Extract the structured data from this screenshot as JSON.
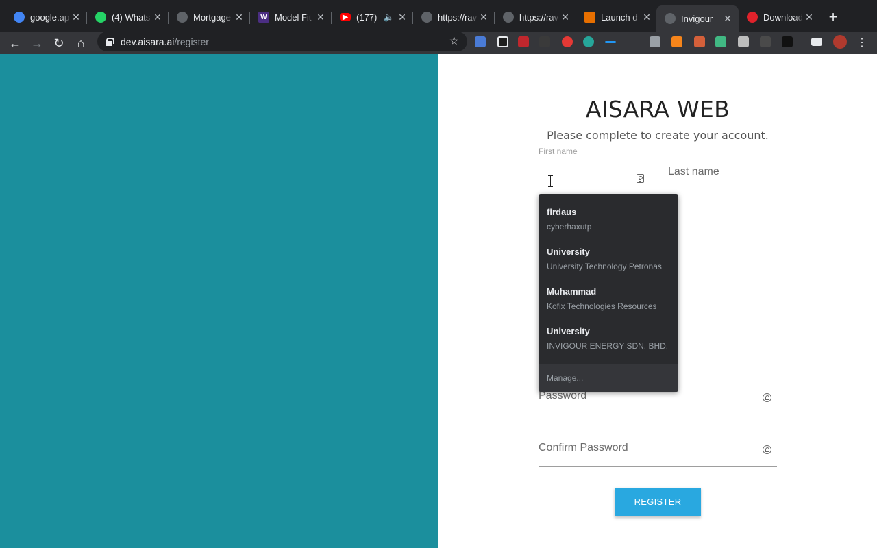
{
  "browser": {
    "tabs": [
      {
        "title": "google.ap",
        "favicon": "google-cloud-icon",
        "color": "#4285f4"
      },
      {
        "title": "(4) Whats",
        "favicon": "whatsapp-icon",
        "color": "#25d366"
      },
      {
        "title": "Mortgage",
        "favicon": "globe-icon",
        "color": "#5f6368"
      },
      {
        "title": "Model Fit",
        "favicon": "w-icon",
        "color": "#4b2e83"
      },
      {
        "title": "(177)",
        "favicon": "youtube-icon",
        "color": "#ff0000"
      },
      {
        "title": "https://rav",
        "favicon": "globe-icon",
        "color": "#5f6368"
      },
      {
        "title": "https://rav",
        "favicon": "globe-icon",
        "color": "#5f6368"
      },
      {
        "title": "Launch d",
        "favicon": "java-icon",
        "color": "#e76f00"
      },
      {
        "title": "Invigour",
        "favicon": "globe-icon",
        "color": "#5f6368"
      },
      {
        "title": "Download",
        "favicon": "opera-icon",
        "color": "#e0222b"
      }
    ],
    "url_host": "dev.aisara.ai",
    "url_path": "/register"
  },
  "page": {
    "title": "AISARA WEB",
    "subtitle": "Please complete to create your account.",
    "left_panel_color": "#1b8f9d",
    "accent_color": "#29a8e0"
  },
  "form": {
    "first_name_label": "First name",
    "last_name_placeholder": "Last name",
    "password_placeholder": "Password",
    "confirm_password_placeholder": "Confirm Password",
    "register_label": "REGISTER"
  },
  "autofill": {
    "items": [
      {
        "name": "firdaus",
        "detail": "cyberhaxutp"
      },
      {
        "name": "University",
        "detail": "University Technology Petronas"
      },
      {
        "name": "Muhammad",
        "detail": "Kofix Technologies Resources"
      },
      {
        "name": "University",
        "detail": "INVIGOUR ENERGY SDN. BHD."
      }
    ],
    "manage_label": "Manage..."
  }
}
